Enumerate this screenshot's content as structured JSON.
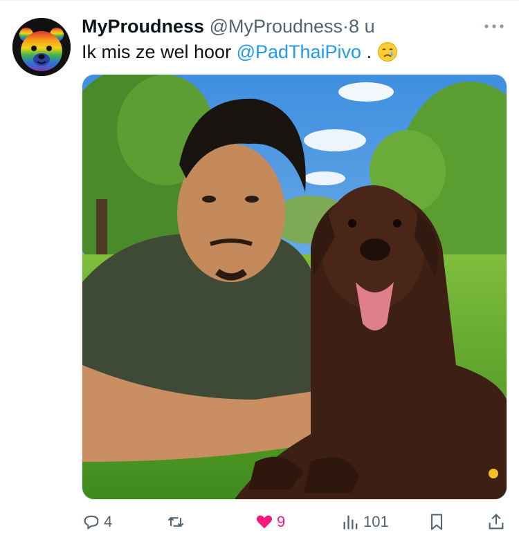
{
  "tweet": {
    "display_name": "MyProudness",
    "handle": "@MyProudness",
    "separator": "·",
    "time": "8 u",
    "text_before": "Ik mis ze wel hoor ",
    "mention": "@PadThaiPivo",
    "text_after": " .",
    "emoji": "crying-face-emoji"
  },
  "media": {
    "subject": "man-with-labrador-photo"
  },
  "actions": {
    "reply_count": "4",
    "repost_count": "",
    "like_count": "9",
    "view_count": "101"
  },
  "colors": {
    "accent": "#1d9bf0",
    "like": "#f91880",
    "muted": "#536471",
    "text": "#0f1419"
  }
}
